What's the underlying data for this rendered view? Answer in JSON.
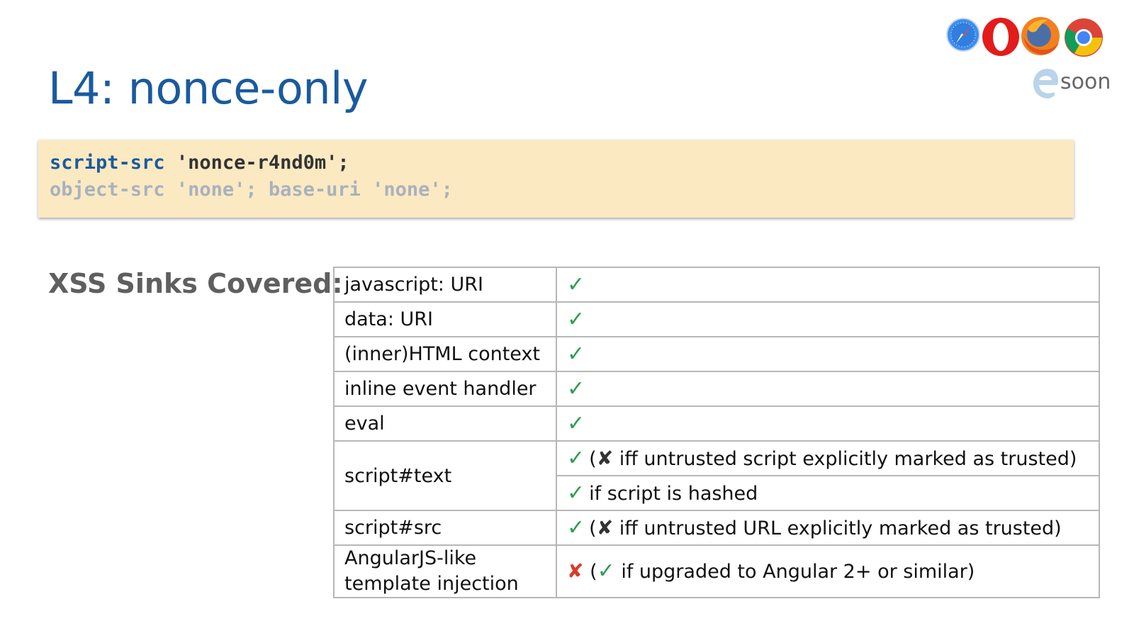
{
  "title": "L4: nonce-only",
  "browsers": {
    "icons": [
      "safari-icon",
      "opera-icon",
      "firefox-icon",
      "chrome-icon",
      "edge-icon"
    ],
    "soon_label": "soon"
  },
  "policy": {
    "line1": {
      "directive": "script-src",
      "value": "'nonce-r4nd0m'",
      "end": ";"
    },
    "line2": "object-src 'none'; base-uri 'none';"
  },
  "sinks_heading": "XSS Sinks Covered:",
  "sinks": [
    {
      "sink": "javascript: URI",
      "status": "✓",
      "note": ""
    },
    {
      "sink": "data: URI",
      "status": "✓",
      "note": ""
    },
    {
      "sink": "(inner)HTML context",
      "status": "✓",
      "note": ""
    },
    {
      "sink": "inline event handler",
      "status": "✓",
      "note": ""
    },
    {
      "sink": "eval",
      "status": "✓",
      "note": ""
    },
    {
      "sink": "script#text",
      "status": "✓",
      "note_pre": "(",
      "note_mark": "✘",
      "note": " iff untrusted script explicitly marked as trusted)"
    },
    {
      "sink": "",
      "status": "✓",
      "note": "if script is hashed"
    },
    {
      "sink": "script#src",
      "status": "✓",
      "note_pre": "(",
      "note_mark": "✘",
      "note": " iff untrusted URL explicitly marked as trusted)"
    },
    {
      "sink_l1": "AngularJS-like",
      "sink_l2": "template injection",
      "status": "✘",
      "note_pre": "(",
      "note_mark": "✓",
      "note": " if upgraded to Angular 2+ or similar)"
    }
  ],
  "colors": {
    "title": "#1a5a9e",
    "code_bg": "#fbe9c2",
    "check": "#2e9e52",
    "cross": "#d93a2b"
  }
}
